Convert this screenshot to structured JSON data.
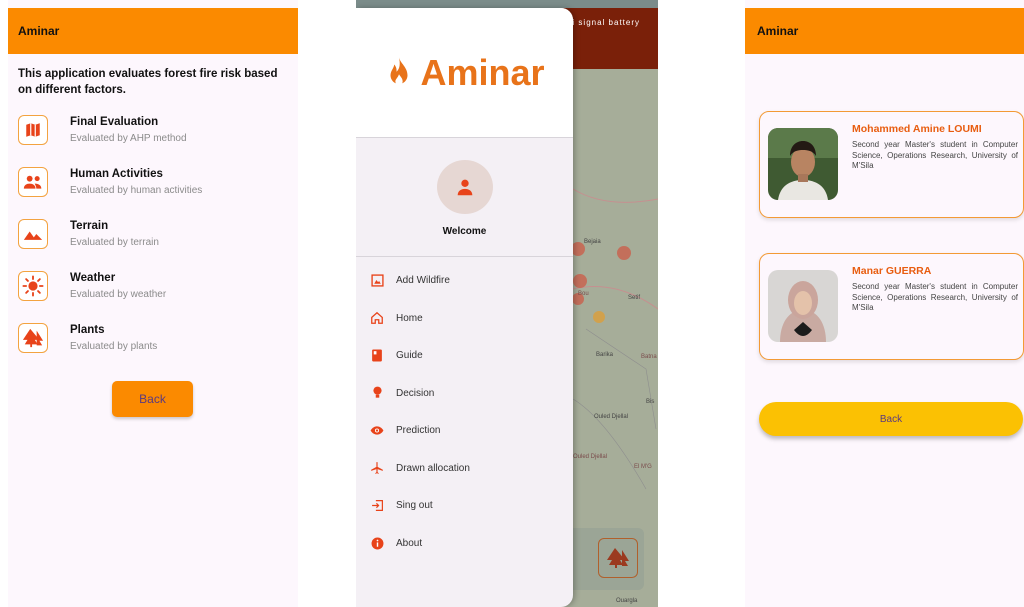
{
  "screen1": {
    "title": "Aminar",
    "intro": "This application evaluates forest fire risk based on different factors.",
    "factors": [
      {
        "title": "Final Evaluation",
        "subtitle": "Evaluated by AHP method",
        "icon": "map-icon"
      },
      {
        "title": "Human Activities",
        "subtitle": "Evaluated by human activities",
        "icon": "people-icon"
      },
      {
        "title": "Terrain",
        "subtitle": "Evaluated by terrain",
        "icon": "terrain-icon"
      },
      {
        "title": "Weather",
        "subtitle": "Evaluated by weather",
        "icon": "sun-icon"
      },
      {
        "title": "Plants",
        "subtitle": "Evaluated by plants",
        "icon": "trees-icon"
      }
    ],
    "back_label": "Back"
  },
  "screen2": {
    "status_icons": "wifi signal battery",
    "logo_text": "Aminar",
    "welcome": "Welcome",
    "menu": [
      {
        "label": "Add Wildfire",
        "icon": "add-wildfire-icon"
      },
      {
        "label": "Home",
        "icon": "home-icon"
      },
      {
        "label": "Guide",
        "icon": "book-icon"
      },
      {
        "label": "Decision",
        "icon": "bulb-icon"
      },
      {
        "label": "Prediction",
        "icon": "eye-icon"
      },
      {
        "label": "Drawn allocation",
        "icon": "plane-icon"
      },
      {
        "label": "Sing out",
        "icon": "exit-icon"
      },
      {
        "label": "About",
        "icon": "info-icon"
      }
    ],
    "map_labels": [
      "Bejaia",
      "Setif",
      "Barika",
      "Batna",
      "Bou",
      "Ouled Djellal",
      "Ouled Djellal",
      "El M'G",
      "Ouargla",
      "Bis"
    ]
  },
  "screen3": {
    "title": "Aminar",
    "people": [
      {
        "name": "Mohammed Amine LOUMI",
        "description": "Second year Master's student in Computer Science, Operations Research, University of M'Sila"
      },
      {
        "name": "Manar GUERRA",
        "description": "Second year Master's student in Computer Science, Operations Research, University of M'Sila"
      }
    ],
    "back_label": "Back"
  },
  "colors": {
    "accent_orange": "#fb8a00",
    "icon_red": "#e8431a",
    "logo_orange": "#e8731a",
    "card_border": "#f39a35",
    "back_yellow": "#fbc103",
    "map_header": "#7a2009"
  }
}
